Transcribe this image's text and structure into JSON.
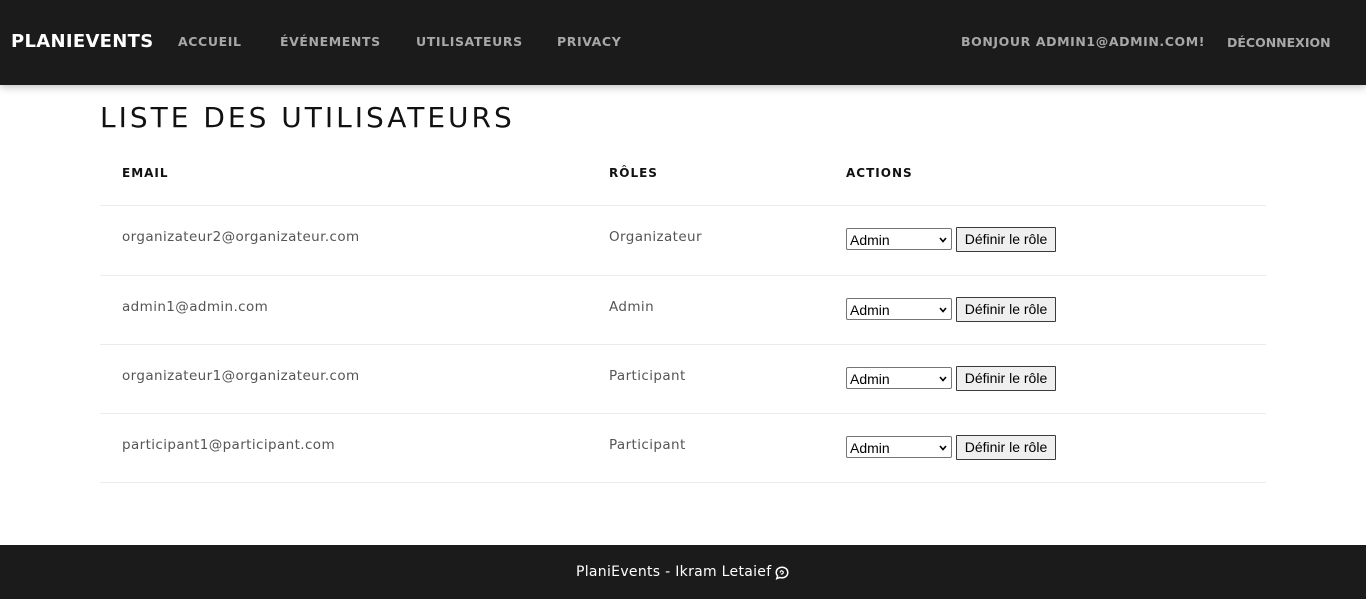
{
  "navbar": {
    "brand": "PLANIEVENTS",
    "links": [
      "ACCUEIL",
      "ÉVÉNEMENTS",
      "UTILISATEURS",
      "PRIVACY"
    ],
    "greeting": "BONJOUR ADMIN1@ADMIN.COM!",
    "logout": "DÉCONNEXION"
  },
  "page": {
    "title": "LISTE DES UTILISATEURS"
  },
  "table": {
    "headers": [
      "EMAIL",
      "RÔLES",
      "ACTIONS"
    ],
    "rows": [
      {
        "email": "organizateur2@organizateur.com",
        "role": "Organizateur",
        "select_value": "Admin",
        "button": "Définir le rôle"
      },
      {
        "email": "admin1@admin.com",
        "role": "Admin",
        "select_value": "Admin",
        "button": "Définir le rôle"
      },
      {
        "email": "organizateur1@organizateur.com",
        "role": "Participant",
        "select_value": "Admin",
        "button": "Définir le rôle"
      },
      {
        "email": "participant1@participant.com",
        "role": "Participant",
        "select_value": "Admin",
        "button": "Définir le rôle"
      }
    ]
  },
  "footer": {
    "text": "PlaniEvents - Ikram Letaief",
    "icon": "chat-icon"
  },
  "colors": {
    "navbar_bg": "#1b1b1b",
    "footer_bg": "#1b1b1b",
    "nav_link": "#a8a8a8",
    "brand": "#ffffff"
  }
}
